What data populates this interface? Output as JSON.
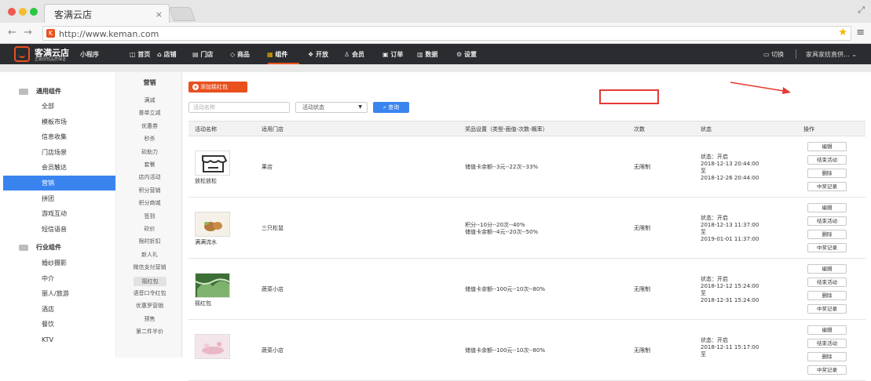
{
  "browser": {
    "tab_title": "客满云店",
    "tab_close": "×",
    "url": "http://www.keman.com",
    "back": "←",
    "forward": "→",
    "star": "★",
    "menu": "≡",
    "expand": "⤢",
    "colors": {
      "red": "#ee5a52",
      "yellow": "#f5bd2e",
      "green": "#27c740"
    }
  },
  "topnav": {
    "brand": "客满云店",
    "brand_sub": "正版授权品质保证",
    "mini_program": "小程序",
    "items": [
      {
        "label": "首页",
        "icon": "home-icon",
        "glyph": "◫"
      },
      {
        "label": "店铺",
        "icon": "store-icon",
        "glyph": "⌂"
      },
      {
        "label": "门店",
        "icon": "shop-icon",
        "glyph": "▤"
      },
      {
        "label": "商品",
        "icon": "tag-icon",
        "glyph": "◇"
      },
      {
        "label": "组件",
        "icon": "grid-icon",
        "glyph": "▦"
      },
      {
        "label": "开放",
        "icon": "cube-icon",
        "glyph": "❖"
      },
      {
        "label": "会员",
        "icon": "user-icon",
        "glyph": "♙"
      },
      {
        "label": "订单",
        "icon": "order-icon",
        "glyph": "▣"
      },
      {
        "label": "数据",
        "icon": "chart-icon",
        "glyph": "▥"
      },
      {
        "label": "设置",
        "icon": "gear-icon",
        "glyph": "⚙"
      }
    ],
    "active_index": 4,
    "switch_label": "切换",
    "shop_name": "家具家纺直供...",
    "accent": "#e8501e"
  },
  "sidebar": {
    "group1": "通用组件",
    "group1_items": [
      "全部",
      "模板市场",
      "信息收集",
      "门店场景",
      "会员触达",
      "营销",
      "拼团",
      "游戏互动",
      "短信语音"
    ],
    "active_index": 5,
    "group2": "行业组件",
    "group2_items": [
      "婚纱摄影",
      "中介",
      "丽人/旅游",
      "酒店",
      "餐饮",
      "KTV"
    ]
  },
  "subnav": {
    "title": "营销",
    "items": [
      "满减",
      "普单立减",
      "优惠券",
      "秒杀",
      "砍助力",
      "套餐",
      "店内活动",
      "积分营销",
      "积分商城",
      "签到",
      "砍价",
      "限时折扣",
      "新人礼",
      "微信支付营销",
      "摇红包",
      "语音口令红包",
      "优惠罗营销",
      "预售",
      "第二件半价"
    ],
    "active_index": 14
  },
  "main": {
    "add_button": "添加摇红包",
    "name_placeholder": "活动名称",
    "status_select": "活动状态",
    "search_button": "查询",
    "columns": [
      "活动名称",
      "适用门店",
      "奖品设置（类型-面值-次数-概率）",
      "次数",
      "状态",
      "操作"
    ],
    "rows": [
      {
        "name": "放松放松",
        "store": "果店",
        "prize1": "储值卡余额--3元--22次--33%",
        "prize2": "",
        "times": "无限制",
        "status_line": "状态：开启",
        "start": "2018-12-13 20:44:00",
        "to": "至",
        "end": "2018-12-26 20:44:00",
        "thumb": "shop-icon"
      },
      {
        "name": "满满流水",
        "store": "三只松鼠",
        "prize1": "积分--10分--20次--40%",
        "prize2": "储值卡余额--4元--20次--50%",
        "times": "无限制",
        "status_line": "状态：开启",
        "start": "2018-12-13 11:37:00",
        "to": "至",
        "end": "2019-01-01 11:37:00",
        "thumb": "nuts-photo"
      },
      {
        "name": "摇红包",
        "store": "蔬菜小店",
        "prize1": "储值卡余额--100元--10次--80%",
        "prize2": "",
        "times": "无限制",
        "status_line": "状态：开启",
        "start": "2018-12-12 15:24:00",
        "to": "至",
        "end": "2018-12-31 15:24:00",
        "thumb": "vegetable-photo"
      },
      {
        "name": "",
        "store": "蔬菜小店",
        "prize1": "储值卡余额--100元--10次--80%",
        "prize2": "",
        "times": "无限制",
        "status_line": "状态：开启",
        "start": "2018-12-11 15:17:00",
        "to": "至",
        "end": "",
        "thumb": "flower-photo"
      }
    ],
    "ops": [
      "编辑",
      "结束活动",
      "删除",
      "中奖记录"
    ]
  }
}
